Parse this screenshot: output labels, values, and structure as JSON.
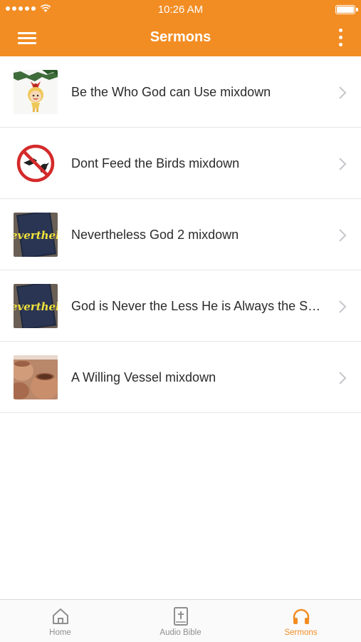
{
  "status": {
    "time": "10:26 AM"
  },
  "header": {
    "title": "Sermons"
  },
  "sermons": [
    {
      "title": "Be the Who God can Use mixdown",
      "thumb": "ornament-doll-image"
    },
    {
      "title": "Dont Feed the Birds mixdown",
      "thumb": "no-feeding-sign-image"
    },
    {
      "title": "Nevertheless God 2 mixdown",
      "thumb": "nevertheless-book-image",
      "thumb_text": "everthele"
    },
    {
      "title": "God is Never the Less He is Always the Same mixdown",
      "thumb": "nevertheless-book-image",
      "thumb_text": "everthele"
    },
    {
      "title": "A Willing Vessel mixdown",
      "thumb": "clay-pots-image"
    }
  ],
  "tabs": [
    {
      "label": "Home",
      "icon": "home-icon",
      "active": false
    },
    {
      "label": "Audio Bible",
      "icon": "bible-icon",
      "active": false
    },
    {
      "label": "Sermons",
      "icon": "headphones-icon",
      "active": true
    }
  ],
  "colors": {
    "accent": "#f28d24",
    "tab_inactive": "#8f8f8f"
  }
}
